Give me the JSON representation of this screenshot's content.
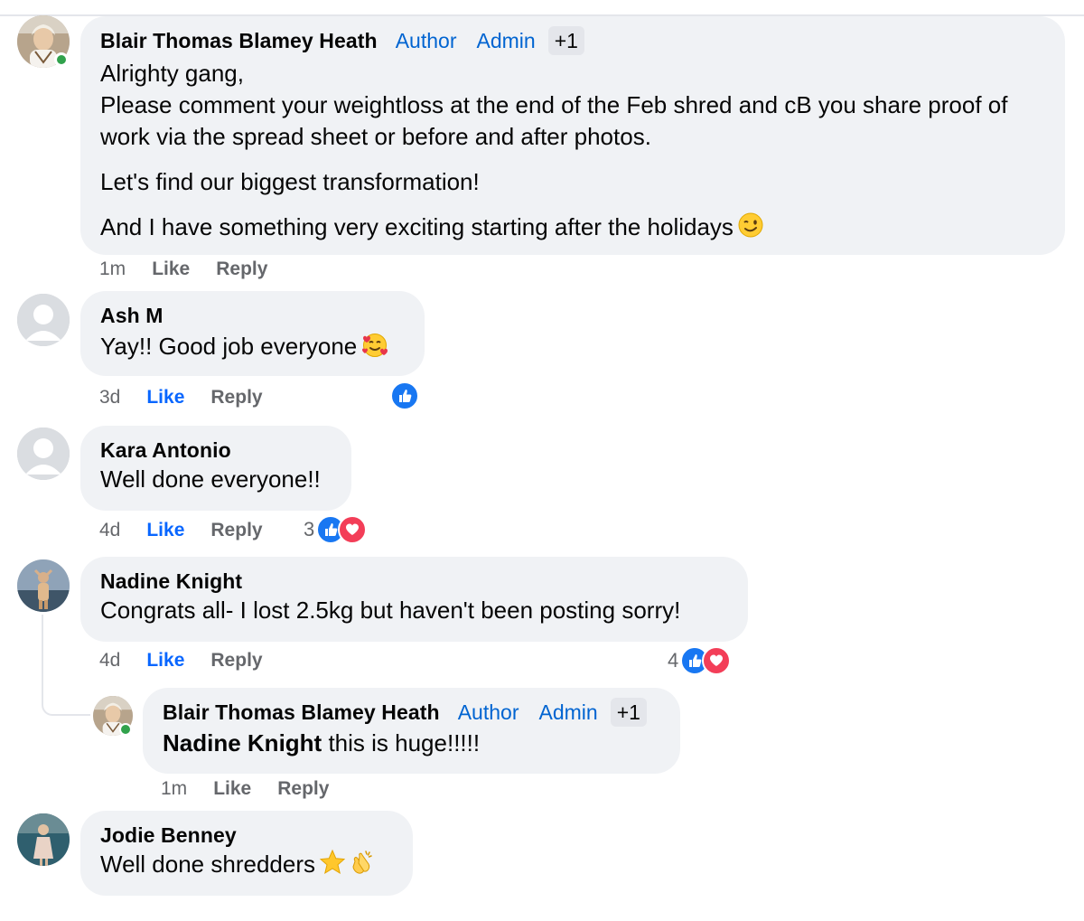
{
  "comments": [
    {
      "author": "Blair Thomas Blamey Heath",
      "roles": [
        "Author",
        "Admin"
      ],
      "extra_badge": "+1",
      "paragraphs": [
        "Alrighty gang,\nPlease comment your weightloss at the end of the Feb shred and cB you share proof of work via the spread sheet or before and after photos.",
        "Let's find our biggest transformation!",
        "And I have something very exciting starting after the holidays"
      ],
      "emoji": "winking-face",
      "time": "1m",
      "like_label": "Like",
      "reply_label": "Reply",
      "liked": false,
      "online": true
    },
    {
      "author": "Ash M",
      "text": "Yay!! Good job everyone",
      "emoji": "smiling-face-with-hearts",
      "time": "3d",
      "like_label": "Like",
      "reply_label": "Reply",
      "liked": true,
      "reactions": [
        "like"
      ]
    },
    {
      "author": "Kara Antonio",
      "text": "Well done everyone!!",
      "time": "4d",
      "like_label": "Like",
      "reply_label": "Reply",
      "liked": true,
      "reaction_count": "3",
      "reactions": [
        "like",
        "love"
      ]
    },
    {
      "author": "Nadine Knight",
      "text": "Congrats all- I lost 2.5kg but haven't been posting sorry!",
      "time": "4d",
      "like_label": "Like",
      "reply_label": "Reply",
      "liked": true,
      "reaction_count": "4",
      "reactions": [
        "like",
        "love"
      ],
      "reply": {
        "author": "Blair Thomas Blamey Heath",
        "roles": [
          "Author",
          "Admin"
        ],
        "extra_badge": "+1",
        "mention": "Nadine Knight",
        "text": " this is huge!!!!!",
        "time": "1m",
        "like_label": "Like",
        "reply_label": "Reply",
        "liked": false,
        "online": true
      }
    },
    {
      "author": "Jodie Benney",
      "text": "Well done shredders",
      "emojis": [
        "star",
        "clapping-hands"
      ]
    }
  ],
  "colors": {
    "bubble": "#f0f2f5",
    "role_blue": "#0064d1",
    "liked_blue": "#0866ff",
    "muted": "#65676b",
    "online_green": "#31a24c",
    "like_reaction": "#1877f2",
    "love_reaction": "#f33e58"
  }
}
